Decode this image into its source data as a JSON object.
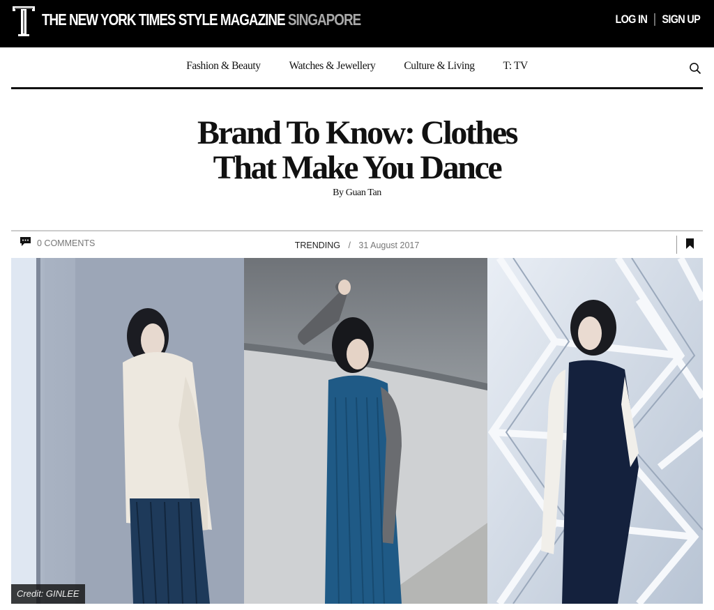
{
  "header": {
    "brand_main": "THE NEW YORK TIMES STYLE MAGAZINE",
    "brand_sub": "SINGAPORE",
    "login_label": "LOG IN",
    "signup_label": "SIGN UP"
  },
  "nav": {
    "items": [
      {
        "label": "Fashion & Beauty"
      },
      {
        "label": "Watches & Jewellery"
      },
      {
        "label": "Culture & Living"
      },
      {
        "label": "T: TV"
      }
    ]
  },
  "article": {
    "title_line1": "Brand To Know: Clothes",
    "title_line2": "That Make You Dance",
    "byline": "By Guan Tan",
    "comments": "0 COMMENTS",
    "category": "TRENDING",
    "separator": "/",
    "date": "31 August 2017",
    "image_credit": "Credit: GINLEE"
  },
  "icons": {
    "logo": "t-magazine-logo",
    "search": "search-icon",
    "comment": "comment-bubble-icon",
    "bookmark": "bookmark-icon"
  },
  "colors": {
    "header_bg": "#000000",
    "brand_sub": "#a8a8a8",
    "meta_text": "#777777"
  }
}
